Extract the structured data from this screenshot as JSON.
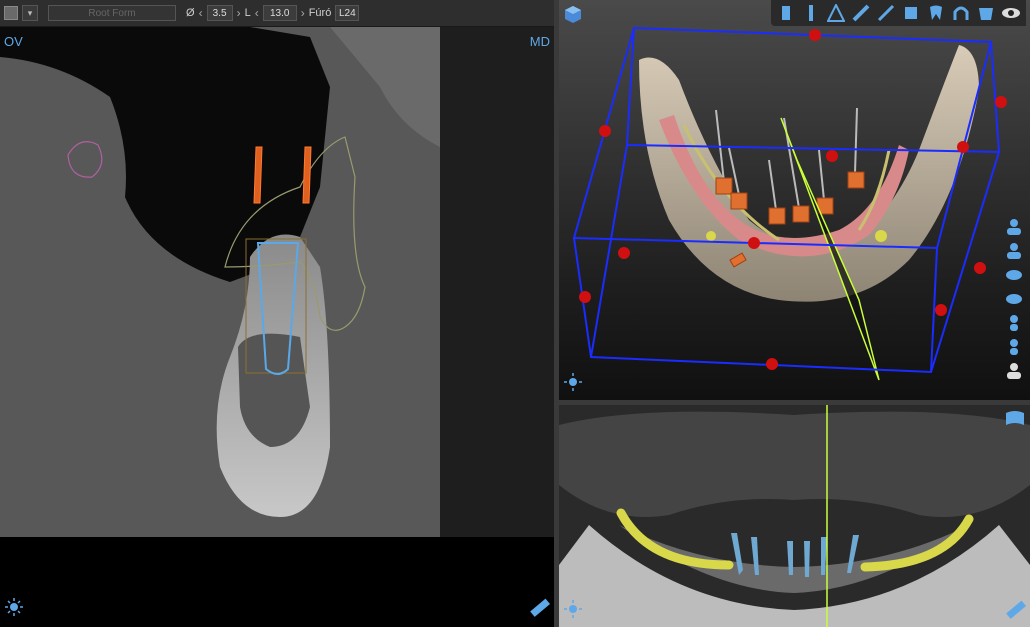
{
  "toolbar": {
    "object_name": "Root Form",
    "diameter_symbol": "Ø",
    "diameter_value": "3.5",
    "length_symbol": "L",
    "length_value": "13.0",
    "drill_label": "Fúró",
    "drill_value": "L24"
  },
  "views": {
    "cross_section": {
      "left_label": "OV",
      "right_label": "MD"
    }
  },
  "icons": {
    "toolbar_3d": [
      "implant-icon",
      "drill-sleeve-icon",
      "annotation-icon",
      "measure-icon",
      "ruler-icon",
      "crown-icon",
      "tooth-icon",
      "arch-icon",
      "jaw-icon",
      "eye-icon"
    ],
    "side_toolbar": [
      "patient-front-icon",
      "patient-back-icon",
      "patient-left-icon",
      "patient-right-icon",
      "patient-top-icon",
      "patient-bottom-icon",
      "patient-reset-icon"
    ]
  },
  "colors": {
    "bounding_box": "#1a2cff",
    "handle": "#d01010",
    "cutting_plane": "#c8ff3a",
    "nerve": "#d8d84a",
    "implant_outline": "#5aa8e8",
    "sleeve": "#ff6a2a",
    "label": "#5fa8e8"
  }
}
